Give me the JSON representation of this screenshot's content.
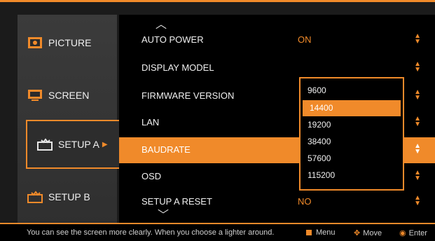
{
  "sidebar": {
    "tabs": [
      {
        "label": "PICTURE",
        "icon": "picture-icon"
      },
      {
        "label": "SCREEN",
        "icon": "screen-icon"
      },
      {
        "label": "SETUP A",
        "icon": "setup-a-icon",
        "active": true
      },
      {
        "label": "SETUP B",
        "icon": "setup-b-icon"
      }
    ]
  },
  "menu": {
    "rows": [
      {
        "label": "AUTO POWER",
        "value": "ON"
      },
      {
        "label": "DISPLAY MODEL",
        "value": ""
      },
      {
        "label": "FIRMWARE VERSION",
        "value": ""
      },
      {
        "label": "LAN",
        "value": ""
      },
      {
        "label": "BAUDRATE",
        "value": "",
        "selected": true
      },
      {
        "label": "OSD",
        "value": ""
      },
      {
        "label": "SETUP A RESET",
        "value": "NO"
      }
    ],
    "scroll_up_icon": "chevron-up-icon",
    "scroll_down_icon": "chevron-down-icon"
  },
  "baudrate_dropdown": {
    "options": [
      "9600",
      "14400",
      "19200",
      "38400",
      "57600",
      "115200"
    ],
    "selected_index": 1
  },
  "status_bar": {
    "hint": "You can see the screen more clearly.  When you choose a lighter around.",
    "menu_label": "Menu",
    "move_label": "Move",
    "enter_label": "Enter"
  },
  "colors": {
    "accent": "#f08a2a",
    "background": "#000000",
    "panel": "#333333"
  }
}
